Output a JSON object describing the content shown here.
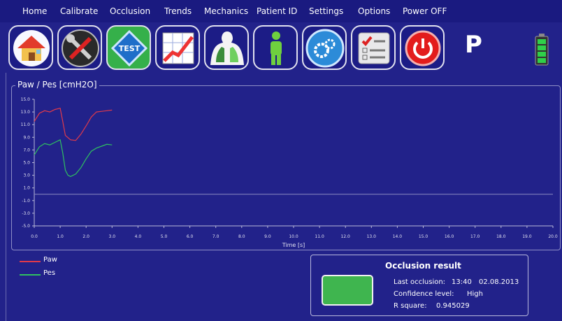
{
  "menu": {
    "home": "Home",
    "calibrate": "Calibrate",
    "occlusion": "Occlusion",
    "trends": "Trends",
    "mechanics": "Mechanics",
    "patient_id": "Patient ID",
    "settings": "Settings",
    "options": "Options",
    "power_off": "Power OFF"
  },
  "toolbar": {
    "icons": [
      "home-icon",
      "tools-icon",
      "test-icon",
      "trends-chart-icon",
      "lungs-icon",
      "patient-icon",
      "settings-gears-icon",
      "checklist-icon",
      "power-icon"
    ],
    "test_label": "TEST",
    "active": "test",
    "mode_letter": "P",
    "battery": "battery-full-icon"
  },
  "chart": {
    "title": "Paw / Pes [cmH2O]",
    "xlabel": "Time [s]"
  },
  "chart_data": {
    "type": "line",
    "title": "Paw / Pes [cmH2O]",
    "xlabel": "Time [s]",
    "ylabel": "",
    "xlim": [
      0,
      20
    ],
    "ylim": [
      -5,
      15
    ],
    "xticks": [
      "0.0",
      "1.0",
      "2.0",
      "3.0",
      "4.0",
      "5.0",
      "6.0",
      "7.0",
      "8.0",
      "9.0",
      "10.0",
      "11.0",
      "12.0",
      "13.0",
      "14.0",
      "15.0",
      "16.0",
      "17.0",
      "18.0",
      "19.0",
      "20.0"
    ],
    "yticks": [
      "15.0",
      "13.0",
      "11.0",
      "9.0",
      "7.0",
      "5.0",
      "3.0",
      "1.0",
      "-1.0",
      "-3.0",
      "-5.0"
    ],
    "baseline": 0,
    "series": [
      {
        "name": "Paw",
        "color": "#e03a4a",
        "x": [
          0.0,
          0.2,
          0.4,
          0.6,
          0.8,
          1.0,
          1.1,
          1.2,
          1.4,
          1.6,
          1.8,
          2.0,
          2.2,
          2.4,
          2.6,
          2.8,
          3.0
        ],
        "y": [
          11.5,
          12.8,
          13.2,
          13.0,
          13.4,
          13.6,
          11.5,
          9.3,
          8.6,
          8.5,
          9.5,
          10.8,
          12.2,
          13.0,
          13.1,
          13.2,
          13.3
        ]
      },
      {
        "name": "Pes",
        "color": "#2fc060",
        "x": [
          0.0,
          0.2,
          0.4,
          0.6,
          0.8,
          1.0,
          1.1,
          1.2,
          1.3,
          1.4,
          1.6,
          1.8,
          2.0,
          2.2,
          2.4,
          2.6,
          2.8,
          3.0
        ],
        "y": [
          6.2,
          7.5,
          8.0,
          7.8,
          8.2,
          8.6,
          6.5,
          3.8,
          3.0,
          2.8,
          3.2,
          4.2,
          5.6,
          6.8,
          7.3,
          7.6,
          7.9,
          7.8
        ]
      }
    ],
    "grid": false,
    "legend": "bottom-left"
  },
  "legend": {
    "paw": "Paw",
    "pes": "Pes",
    "paw_color": "#e03a4a",
    "pes_color": "#2fc060"
  },
  "result": {
    "title": "Occlusion result",
    "last_occlusion_label": "Last occlusion:",
    "last_occlusion_time": "13:40",
    "last_occlusion_date": "02.08.2013",
    "confidence_label": "Confidence level:",
    "confidence_value": "High",
    "rsquare_label": "R square:",
    "rsquare_value": "0.945029",
    "status_color": "#3fb54f"
  }
}
